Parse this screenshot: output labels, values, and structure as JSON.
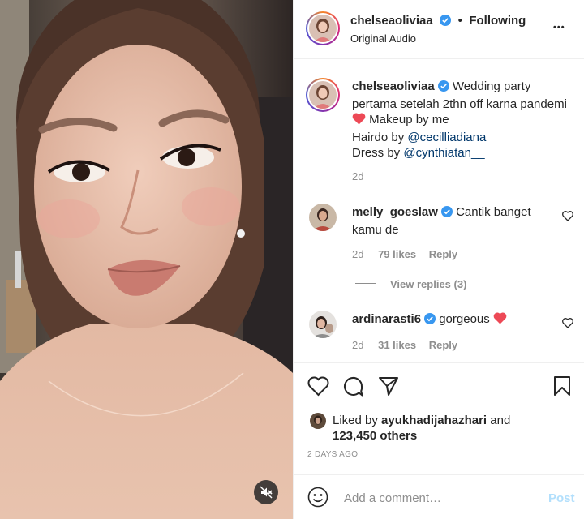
{
  "post": {
    "username": "chelseaoliviaa",
    "follow_separator": "•",
    "follow_status": "Following",
    "audio": "Original Audio",
    "more": "•••"
  },
  "caption": {
    "username": "chelseaoliviaa",
    "line1": "Wedding party",
    "line2": "pertama setelah 2thn off karna pandemi",
    "line3": "Makeup by me",
    "hairdo_prefix": "Hairdo by",
    "hairdo_mention": "@cecilliadiana",
    "dress_prefix": "Dress by",
    "dress_mention": "@cynthiatan__",
    "age": "2d"
  },
  "comments": [
    {
      "username": "melly_goeslaw",
      "text_line1": "Cantik banget",
      "text_line2": "kamu de",
      "age": "2d",
      "likes": "79 likes",
      "reply": "Reply",
      "view_replies": "View replies (3)"
    },
    {
      "username": "ardinarasti6",
      "text": "gorgeous",
      "age": "2d",
      "likes": "31 likes",
      "reply": "Reply"
    }
  ],
  "likes": {
    "prefix": "Liked by",
    "user": "ayukhadijahazhari",
    "conjunction": "and",
    "others": "123,450 others"
  },
  "timestamp": "2 DAYS AGO",
  "add_comment": {
    "placeholder": "Add a comment…",
    "post_label": "Post"
  },
  "colors": {
    "verified": "#3897f0",
    "heart_red": "#ed4956",
    "link": "#00376b",
    "muted": "#8e8e8e",
    "post_disabled": "#b2dffc"
  }
}
